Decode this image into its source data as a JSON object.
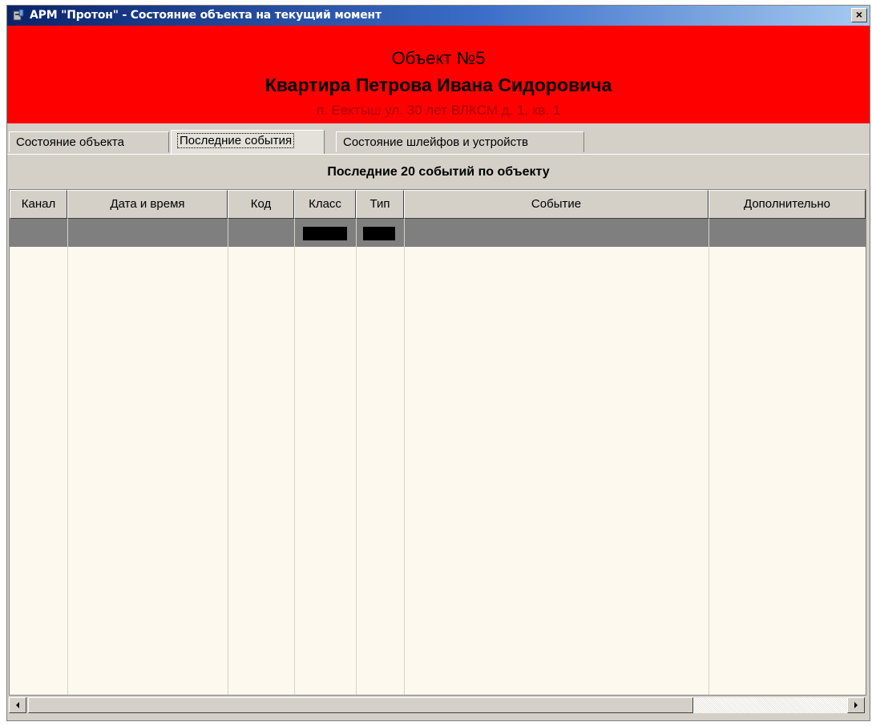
{
  "window": {
    "title": "АРМ \"Протон\" - Состояние объекта на текущий момент",
    "close_glyph": "×"
  },
  "banner": {
    "object_number": "Объект №5",
    "object_name": "Квартира Петрова Ивана Сидоровича",
    "address": "п. Еектыш  ул. 30  лет ВЛКСМ   д. 1, кв. 1",
    "background_color": "#ff0000"
  },
  "tabs": [
    {
      "label": "Состояние объекта",
      "active": false
    },
    {
      "label": "Последние события",
      "active": true
    },
    {
      "label": "Состояние шлейфов и устройств",
      "active": false
    }
  ],
  "events": {
    "title": "Последние 20 событий по объекту",
    "columns": [
      "Канал",
      "Дата и время",
      "Код",
      "Класс",
      "Тип",
      "Событие",
      "Дополнительно"
    ]
  },
  "icons": {
    "app": "app-icon",
    "close": "close-icon",
    "scroll_left": "arrow-left-icon",
    "scroll_right": "arrow-right-icon"
  }
}
